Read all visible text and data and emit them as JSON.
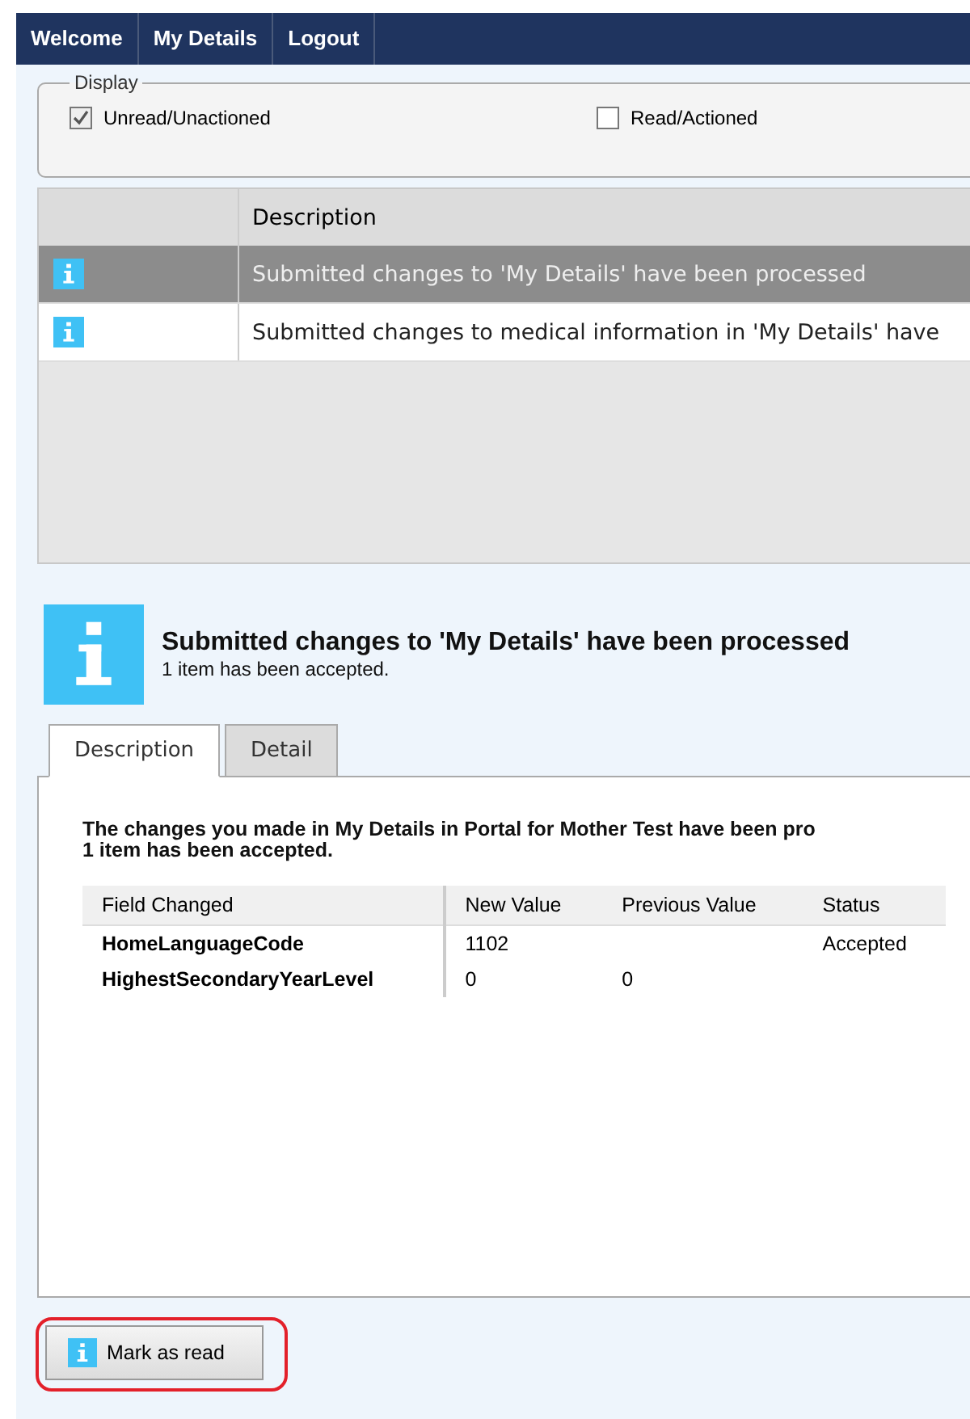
{
  "nav": [
    {
      "label": "Welcome"
    },
    {
      "label": "My Details"
    },
    {
      "label": "Logout"
    }
  ],
  "display": {
    "legend": "Display",
    "options": [
      {
        "label": "Unread/Unactioned",
        "checked": true
      },
      {
        "label": "Read/Actioned",
        "checked": false
      }
    ]
  },
  "messages": {
    "columns": [
      "Description"
    ],
    "rows": [
      {
        "description": "Submitted changes to 'My Details' have been processed",
        "selected": true
      },
      {
        "description": "Submitted changes to medical information in 'My Details' have",
        "selected": false
      }
    ]
  },
  "detail": {
    "title": "Submitted changes to 'My Details' have been processed",
    "subtitle": "1 item has been accepted.",
    "tabs": [
      {
        "label": "Description",
        "selected": true
      },
      {
        "label": "Detail",
        "selected": false
      }
    ],
    "body": "The changes you made in My Details in Portal for Mother Test have been pro",
    "body_line2": "1 item has been accepted.",
    "table": {
      "columns": [
        "Field Changed",
        "New Value",
        "Previous Value",
        "Status"
      ],
      "rows": [
        [
          "HomeLanguageCode",
          "1102",
          "",
          "Accepted"
        ],
        [
          "HighestSecondaryYearLevel",
          "0",
          "0",
          ""
        ]
      ]
    }
  },
  "button": {
    "label": "Mark as read",
    "highlighted": true
  }
}
